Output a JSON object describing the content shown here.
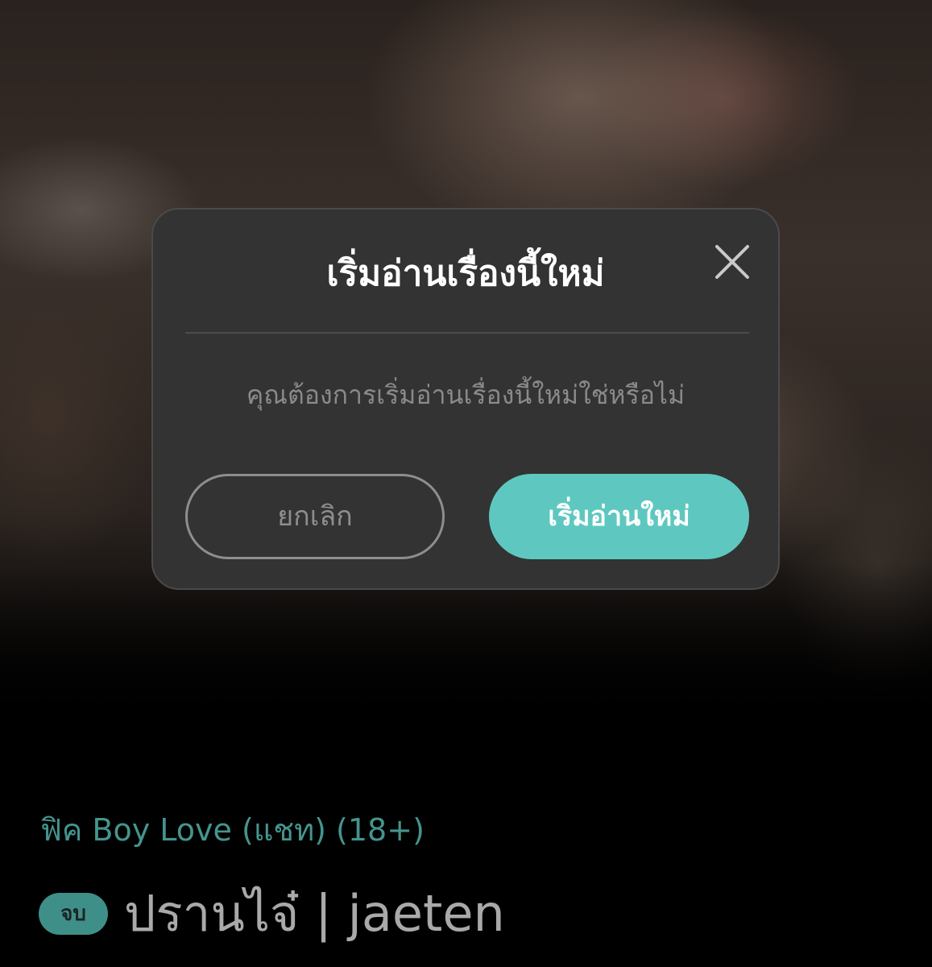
{
  "modal": {
    "title": "เริ่มอ่านเรื่องนี้ใหม่",
    "message": "คุณต้องการเริ่มอ่านเรื่องนี้ใหม่ใช่หรือไม่",
    "cancel_label": "ยกเลิก",
    "confirm_label": "เริ่มอ่านใหม่",
    "close_icon": "close-icon"
  },
  "story": {
    "category": "ฟิค Boy Love (แชท) (18+)",
    "status_badge": "จบ",
    "title": "ปรานไจ๋ | jaeten"
  },
  "colors": {
    "accent": "#5ec8c0",
    "category_text": "#45948e",
    "badge_bg": "#3f8f89",
    "modal_bg": "#333333"
  }
}
